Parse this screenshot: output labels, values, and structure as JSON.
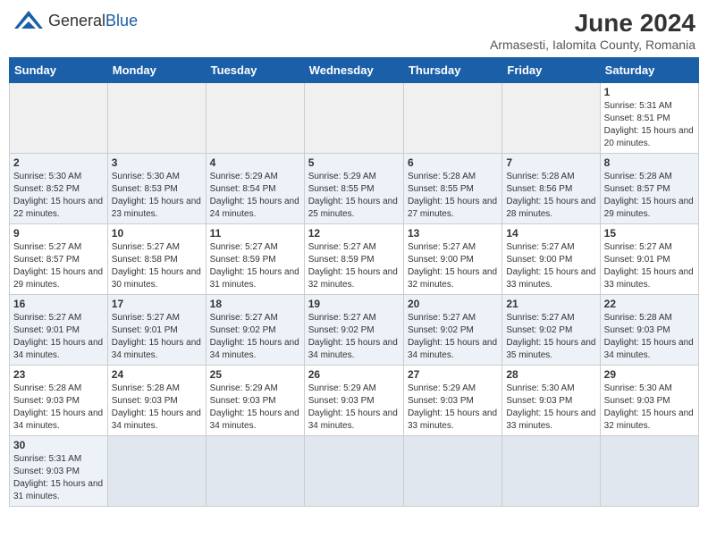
{
  "header": {
    "logo_general": "General",
    "logo_blue": "Blue",
    "month_year": "June 2024",
    "location": "Armasesti, Ialomita County, Romania"
  },
  "days_of_week": [
    "Sunday",
    "Monday",
    "Tuesday",
    "Wednesday",
    "Thursday",
    "Friday",
    "Saturday"
  ],
  "weeks": [
    [
      {
        "day": "",
        "info": ""
      },
      {
        "day": "",
        "info": ""
      },
      {
        "day": "",
        "info": ""
      },
      {
        "day": "",
        "info": ""
      },
      {
        "day": "",
        "info": ""
      },
      {
        "day": "",
        "info": ""
      },
      {
        "day": "1",
        "info": "Sunrise: 5:31 AM\nSunset: 8:51 PM\nDaylight: 15 hours and 20 minutes."
      }
    ],
    [
      {
        "day": "2",
        "info": "Sunrise: 5:30 AM\nSunset: 8:52 PM\nDaylight: 15 hours and 22 minutes."
      },
      {
        "day": "3",
        "info": "Sunrise: 5:30 AM\nSunset: 8:53 PM\nDaylight: 15 hours and 23 minutes."
      },
      {
        "day": "4",
        "info": "Sunrise: 5:29 AM\nSunset: 8:54 PM\nDaylight: 15 hours and 24 minutes."
      },
      {
        "day": "5",
        "info": "Sunrise: 5:29 AM\nSunset: 8:55 PM\nDaylight: 15 hours and 25 minutes."
      },
      {
        "day": "6",
        "info": "Sunrise: 5:28 AM\nSunset: 8:55 PM\nDaylight: 15 hours and 27 minutes."
      },
      {
        "day": "7",
        "info": "Sunrise: 5:28 AM\nSunset: 8:56 PM\nDaylight: 15 hours and 28 minutes."
      },
      {
        "day": "8",
        "info": "Sunrise: 5:28 AM\nSunset: 8:57 PM\nDaylight: 15 hours and 29 minutes."
      }
    ],
    [
      {
        "day": "9",
        "info": "Sunrise: 5:27 AM\nSunset: 8:57 PM\nDaylight: 15 hours and 29 minutes."
      },
      {
        "day": "10",
        "info": "Sunrise: 5:27 AM\nSunset: 8:58 PM\nDaylight: 15 hours and 30 minutes."
      },
      {
        "day": "11",
        "info": "Sunrise: 5:27 AM\nSunset: 8:59 PM\nDaylight: 15 hours and 31 minutes."
      },
      {
        "day": "12",
        "info": "Sunrise: 5:27 AM\nSunset: 8:59 PM\nDaylight: 15 hours and 32 minutes."
      },
      {
        "day": "13",
        "info": "Sunrise: 5:27 AM\nSunset: 9:00 PM\nDaylight: 15 hours and 32 minutes."
      },
      {
        "day": "14",
        "info": "Sunrise: 5:27 AM\nSunset: 9:00 PM\nDaylight: 15 hours and 33 minutes."
      },
      {
        "day": "15",
        "info": "Sunrise: 5:27 AM\nSunset: 9:01 PM\nDaylight: 15 hours and 33 minutes."
      }
    ],
    [
      {
        "day": "16",
        "info": "Sunrise: 5:27 AM\nSunset: 9:01 PM\nDaylight: 15 hours and 34 minutes."
      },
      {
        "day": "17",
        "info": "Sunrise: 5:27 AM\nSunset: 9:01 PM\nDaylight: 15 hours and 34 minutes."
      },
      {
        "day": "18",
        "info": "Sunrise: 5:27 AM\nSunset: 9:02 PM\nDaylight: 15 hours and 34 minutes."
      },
      {
        "day": "19",
        "info": "Sunrise: 5:27 AM\nSunset: 9:02 PM\nDaylight: 15 hours and 34 minutes."
      },
      {
        "day": "20",
        "info": "Sunrise: 5:27 AM\nSunset: 9:02 PM\nDaylight: 15 hours and 34 minutes."
      },
      {
        "day": "21",
        "info": "Sunrise: 5:27 AM\nSunset: 9:02 PM\nDaylight: 15 hours and 35 minutes."
      },
      {
        "day": "22",
        "info": "Sunrise: 5:28 AM\nSunset: 9:03 PM\nDaylight: 15 hours and 34 minutes."
      }
    ],
    [
      {
        "day": "23",
        "info": "Sunrise: 5:28 AM\nSunset: 9:03 PM\nDaylight: 15 hours and 34 minutes."
      },
      {
        "day": "24",
        "info": "Sunrise: 5:28 AM\nSunset: 9:03 PM\nDaylight: 15 hours and 34 minutes."
      },
      {
        "day": "25",
        "info": "Sunrise: 5:29 AM\nSunset: 9:03 PM\nDaylight: 15 hours and 34 minutes."
      },
      {
        "day": "26",
        "info": "Sunrise: 5:29 AM\nSunset: 9:03 PM\nDaylight: 15 hours and 34 minutes."
      },
      {
        "day": "27",
        "info": "Sunrise: 5:29 AM\nSunset: 9:03 PM\nDaylight: 15 hours and 33 minutes."
      },
      {
        "day": "28",
        "info": "Sunrise: 5:30 AM\nSunset: 9:03 PM\nDaylight: 15 hours and 33 minutes."
      },
      {
        "day": "29",
        "info": "Sunrise: 5:30 AM\nSunset: 9:03 PM\nDaylight: 15 hours and 32 minutes."
      }
    ],
    [
      {
        "day": "30",
        "info": "Sunrise: 5:31 AM\nSunset: 9:03 PM\nDaylight: 15 hours and 31 minutes."
      },
      {
        "day": "",
        "info": ""
      },
      {
        "day": "",
        "info": ""
      },
      {
        "day": "",
        "info": ""
      },
      {
        "day": "",
        "info": ""
      },
      {
        "day": "",
        "info": ""
      },
      {
        "day": "",
        "info": ""
      }
    ]
  ]
}
